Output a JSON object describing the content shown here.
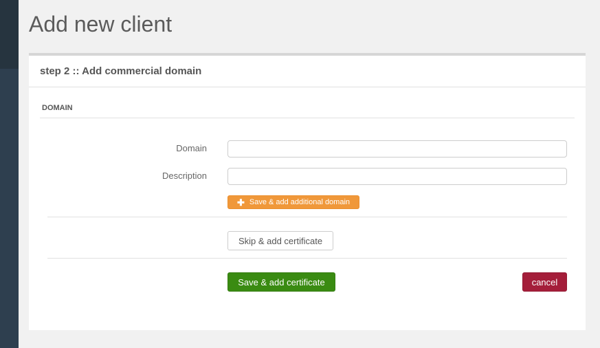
{
  "page": {
    "title": "Add new client"
  },
  "panel": {
    "title": "step 2 :: Add commercial domain",
    "section_title": "DOMAIN"
  },
  "form": {
    "domain_label": "Domain",
    "domain_value": "",
    "description_label": "Description",
    "description_value": "",
    "add_domain_button": "Save & add additional domain",
    "skip_button": "Skip & add certificate",
    "save_button": "Save & add certificate",
    "cancel_button": "cancel"
  },
  "colors": {
    "sidebar": "#2e3f4f",
    "orange": "#f0983a",
    "green": "#3a8b12",
    "red": "#a41e3a"
  },
  "icons": {
    "add_domain_icon": "plus-icon"
  }
}
